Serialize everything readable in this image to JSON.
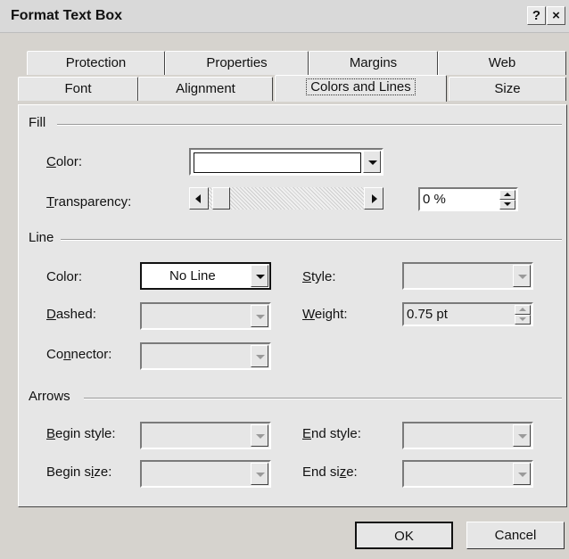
{
  "window": {
    "title": "Format Text Box",
    "help": "?",
    "close": "×"
  },
  "tabs_back": [
    "Protection",
    "Properties",
    "Margins",
    "Web"
  ],
  "tabs_front": [
    "Font",
    "Alignment",
    "Colors and Lines",
    "Size"
  ],
  "active_tab": "Colors and Lines",
  "fill": {
    "group": "Fill",
    "color_label": {
      "pre": "",
      "key": "C",
      "post": "olor:"
    },
    "color_value": "",
    "transparency_label": {
      "pre": "",
      "key": "T",
      "post": "ransparency:"
    },
    "transparency_value": "0 %",
    "transparency_level": 0
  },
  "line": {
    "group": "Line",
    "color_label": "Color:",
    "color_value": "No Line",
    "dashed_label": {
      "pre": "",
      "key": "D",
      "post": "ashed:"
    },
    "connector_label": {
      "pre": "Co",
      "key": "n",
      "post": "nector:"
    },
    "style_label": {
      "pre": "",
      "key": "S",
      "post": "tyle:"
    },
    "weight_label": {
      "pre": "",
      "key": "W",
      "post": "eight:"
    },
    "weight_value": "0.75 pt"
  },
  "arrows": {
    "group": "Arrows",
    "begin_style_label": {
      "pre": "",
      "key": "B",
      "post": "egin style:"
    },
    "begin_size_label": {
      "pre": "Begin s",
      "key": "i",
      "post": "ze:"
    },
    "end_style_label": {
      "pre": "",
      "key": "E",
      "post": "nd style:"
    },
    "end_size_label": {
      "pre": "End si",
      "key": "z",
      "post": "e:"
    }
  },
  "buttons": {
    "ok": "OK",
    "cancel": "Cancel"
  }
}
